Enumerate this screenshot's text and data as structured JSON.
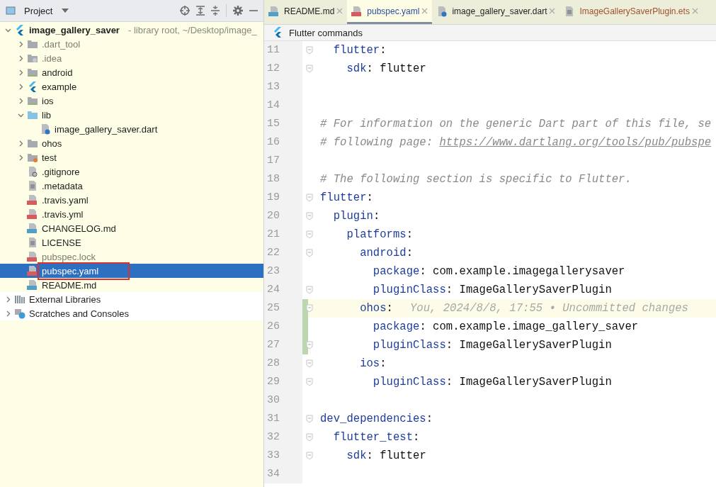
{
  "project_panel": {
    "title": "Project",
    "tree": [
      {
        "label": "image_gallery_saver",
        "note": "- library root, ~/Desktop/image_",
        "kind": "flutter",
        "expanded": true,
        "selected": false,
        "dimmed": false,
        "children": [
          {
            "label": ".dart_tool",
            "kind": "folder",
            "expanded": false,
            "selected": false,
            "dimmed": true
          },
          {
            "label": ".idea",
            "kind": "config-folder",
            "expanded": false,
            "selected": false,
            "dimmed": true
          },
          {
            "label": "android",
            "kind": "module-folder",
            "expanded": false,
            "selected": false,
            "dimmed": false
          },
          {
            "label": "example",
            "kind": "flutter",
            "expanded": false,
            "selected": false,
            "dimmed": false
          },
          {
            "label": "ios",
            "kind": "module-folder",
            "expanded": false,
            "selected": false,
            "dimmed": false
          },
          {
            "label": "lib",
            "kind": "source-folder",
            "expanded": true,
            "selected": false,
            "dimmed": false,
            "children": [
              {
                "label": "image_gallery_saver.dart",
                "kind": "dart",
                "selected": false,
                "dimmed": false
              }
            ]
          },
          {
            "label": "ohos",
            "kind": "folder",
            "expanded": false,
            "selected": false,
            "dimmed": false
          },
          {
            "label": "test",
            "kind": "test-folder",
            "expanded": false,
            "selected": false,
            "dimmed": false
          },
          {
            "label": ".gitignore",
            "kind": "ignore",
            "selected": false,
            "dimmed": false
          },
          {
            "label": ".metadata",
            "kind": "text",
            "selected": false,
            "dimmed": false
          },
          {
            "label": ".travis.yaml",
            "kind": "yml",
            "selected": false,
            "dimmed": false
          },
          {
            "label": ".travis.yml",
            "kind": "yml",
            "selected": false,
            "dimmed": false
          },
          {
            "label": "CHANGELOG.md",
            "kind": "md",
            "selected": false,
            "dimmed": false
          },
          {
            "label": "LICENSE",
            "kind": "text",
            "selected": false,
            "dimmed": false
          },
          {
            "label": "pubspec.lock",
            "kind": "yml",
            "selected": false,
            "dimmed": true
          },
          {
            "label": "pubspec.yaml",
            "kind": "yml",
            "selected": true,
            "dimmed": false,
            "highlighted": true
          },
          {
            "label": "README.md",
            "kind": "md",
            "selected": false,
            "dimmed": false
          }
        ]
      },
      {
        "label": "External Libraries",
        "kind": "library",
        "expanded": false,
        "selected": false,
        "dimmed": false
      },
      {
        "label": "Scratches and Consoles",
        "kind": "scratches",
        "expanded": false,
        "selected": false,
        "dimmed": false
      }
    ]
  },
  "tabs": [
    {
      "label": "README.md",
      "kind": "md",
      "selected": false,
      "color": "#1e1e1e"
    },
    {
      "label": "pubspec.yaml",
      "kind": "yml",
      "selected": true,
      "color": "#2a4f9e"
    },
    {
      "label": "image_gallery_saver.dart",
      "kind": "dart",
      "selected": false,
      "color": "#1e1e1e"
    },
    {
      "label": "ImageGallerySaverPlugin.ets",
      "kind": "text",
      "selected": false,
      "color": "#a0522d"
    }
  ],
  "toolbar": {
    "label": "Flutter commands"
  },
  "editor": {
    "lines": [
      {
        "number": "11",
        "fold": true,
        "changed": false,
        "current": false,
        "parts": [
          {
            "kind": "key",
            "text": "  flutter"
          },
          {
            "kind": "punct",
            "text": ":"
          }
        ]
      },
      {
        "number": "12",
        "fold": true,
        "changed": false,
        "current": false,
        "parts": [
          {
            "kind": "key",
            "text": "    sdk"
          },
          {
            "kind": "punct",
            "text": ": "
          },
          {
            "kind": "value",
            "text": "flutter"
          }
        ]
      },
      {
        "number": "13",
        "fold": false,
        "changed": false,
        "current": false
      },
      {
        "number": "14",
        "fold": false,
        "changed": false,
        "current": false
      },
      {
        "number": "15",
        "fold": false,
        "changed": false,
        "current": false,
        "parts": [
          {
            "kind": "comment",
            "text": "# For information on the generic Dart part of this file, se"
          }
        ]
      },
      {
        "number": "16",
        "fold": false,
        "changed": false,
        "current": false,
        "parts": [
          {
            "kind": "comment",
            "text": "# following page: "
          },
          {
            "kind": "link",
            "text": "https://www.dartlang.org/tools/pub/pubspe"
          }
        ]
      },
      {
        "number": "17",
        "fold": false,
        "changed": false,
        "current": false
      },
      {
        "number": "18",
        "fold": false,
        "changed": false,
        "current": false,
        "parts": [
          {
            "kind": "comment",
            "text": "# The following section is specific to Flutter."
          }
        ]
      },
      {
        "number": "19",
        "fold": true,
        "changed": false,
        "current": false,
        "parts": [
          {
            "kind": "key",
            "text": "flutter"
          },
          {
            "kind": "punct",
            "text": ":"
          }
        ]
      },
      {
        "number": "20",
        "fold": true,
        "changed": false,
        "current": false,
        "parts": [
          {
            "kind": "key",
            "text": "  plugin"
          },
          {
            "kind": "punct",
            "text": ":"
          }
        ]
      },
      {
        "number": "21",
        "fold": true,
        "changed": false,
        "current": false,
        "parts": [
          {
            "kind": "key",
            "text": "    platforms"
          },
          {
            "kind": "punct",
            "text": ":"
          }
        ]
      },
      {
        "number": "22",
        "fold": true,
        "changed": false,
        "current": false,
        "parts": [
          {
            "kind": "key",
            "text": "      android"
          },
          {
            "kind": "punct",
            "text": ":"
          }
        ]
      },
      {
        "number": "23",
        "fold": false,
        "changed": false,
        "current": false,
        "parts": [
          {
            "kind": "key",
            "text": "        package"
          },
          {
            "kind": "punct",
            "text": ": "
          },
          {
            "kind": "value",
            "text": "com.example.imagegallerysaver"
          }
        ]
      },
      {
        "number": "24",
        "fold": true,
        "changed": false,
        "current": false,
        "parts": [
          {
            "kind": "key",
            "text": "        pluginClass"
          },
          {
            "kind": "punct",
            "text": ": "
          },
          {
            "kind": "value",
            "text": "ImageGallerySaverPlugin"
          }
        ]
      },
      {
        "number": "25",
        "fold": true,
        "changed": true,
        "current": true,
        "parts": [
          {
            "kind": "key",
            "text": "      ohos"
          },
          {
            "kind": "punct",
            "text": ":"
          },
          {
            "kind": "blame",
            "text": "You, 2024/8/8, 17:55 • Uncommitted changes"
          }
        ]
      },
      {
        "number": "26",
        "fold": false,
        "changed": true,
        "current": false,
        "parts": [
          {
            "kind": "key",
            "text": "        package"
          },
          {
            "kind": "punct",
            "text": ": "
          },
          {
            "kind": "value",
            "text": "com.example.image_gallery_saver"
          }
        ]
      },
      {
        "number": "27",
        "fold": true,
        "changed": true,
        "current": false,
        "parts": [
          {
            "kind": "key",
            "text": "        pluginClass"
          },
          {
            "kind": "punct",
            "text": ": "
          },
          {
            "kind": "value",
            "text": "ImageGallerySaverPlugin"
          }
        ]
      },
      {
        "number": "28",
        "fold": true,
        "changed": false,
        "current": false,
        "parts": [
          {
            "kind": "key",
            "text": "      ios"
          },
          {
            "kind": "punct",
            "text": ":"
          }
        ]
      },
      {
        "number": "29",
        "fold": true,
        "changed": false,
        "current": false,
        "parts": [
          {
            "kind": "key",
            "text": "        pluginClass"
          },
          {
            "kind": "punct",
            "text": ": "
          },
          {
            "kind": "value",
            "text": "ImageGallerySaverPlugin"
          }
        ]
      },
      {
        "number": "30",
        "fold": false,
        "changed": false,
        "current": false
      },
      {
        "number": "31",
        "fold": true,
        "changed": false,
        "current": false,
        "parts": [
          {
            "kind": "key",
            "text": "dev_dependencies"
          },
          {
            "kind": "punct",
            "text": ":"
          }
        ]
      },
      {
        "number": "32",
        "fold": true,
        "changed": false,
        "current": false,
        "parts": [
          {
            "kind": "key",
            "text": "  flutter_test"
          },
          {
            "kind": "punct",
            "text": ":"
          }
        ]
      },
      {
        "number": "33",
        "fold": true,
        "changed": false,
        "current": false,
        "parts": [
          {
            "kind": "key",
            "text": "    sdk"
          },
          {
            "kind": "punct",
            "text": ": "
          },
          {
            "kind": "value",
            "text": "flutter"
          }
        ]
      },
      {
        "number": "34",
        "fold": false,
        "changed": false,
        "current": false
      }
    ]
  }
}
